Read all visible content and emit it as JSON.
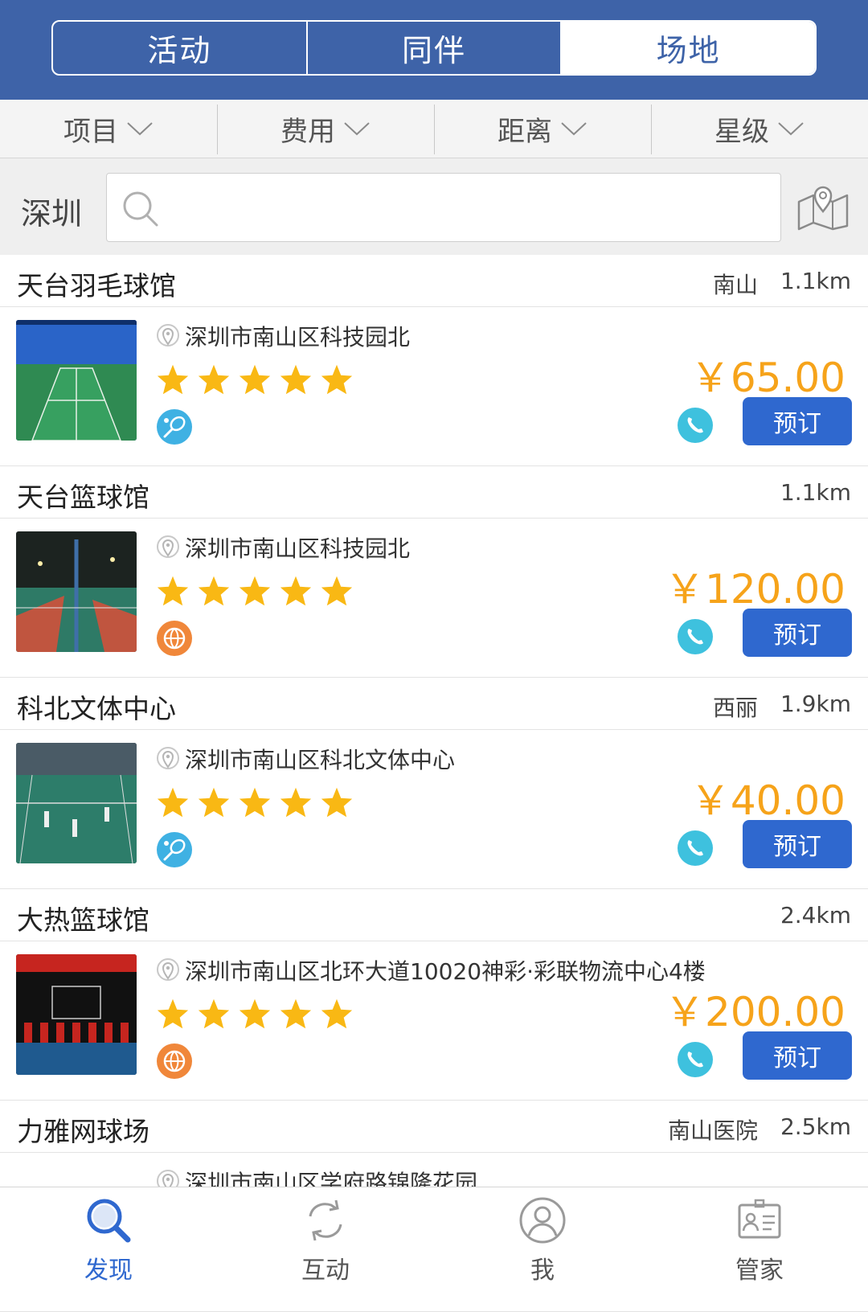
{
  "header": {
    "tabs": [
      {
        "label": "活动",
        "active": false
      },
      {
        "label": "同伴",
        "active": false
      },
      {
        "label": "场地",
        "active": true
      }
    ]
  },
  "filters": [
    "项目",
    "费用",
    "距离",
    "星级"
  ],
  "search": {
    "city": "深圳",
    "value": "",
    "placeholder": ""
  },
  "venues": [
    {
      "name": "天台羽毛球馆",
      "area": "南山",
      "distance": "1.1km",
      "address": "深圳市南山区科技园北",
      "rating": 5,
      "sport_icon": "badminton-icon",
      "price": "￥65.00",
      "book_label": "预订"
    },
    {
      "name": "天台篮球馆",
      "area": "",
      "distance": "1.1km",
      "address": "深圳市南山区科技园北",
      "rating": 5,
      "sport_icon": "basketball-icon",
      "price": "￥120.00",
      "book_label": "预订"
    },
    {
      "name": "科北文体中心",
      "area": "西丽",
      "distance": "1.9km",
      "address": "深圳市南山区科北文体中心",
      "rating": 5,
      "sport_icon": "badminton-icon",
      "price": "￥40.00",
      "book_label": "预订"
    },
    {
      "name": "大热篮球馆",
      "area": "",
      "distance": "2.4km",
      "address": "深圳市南山区北环大道10020神彩·彩联物流中心4楼",
      "rating": 5,
      "sport_icon": "basketball-icon",
      "price": "￥200.00",
      "book_label": "预订"
    },
    {
      "name": "力雅网球场",
      "area": "南山医院",
      "distance": "2.5km",
      "address": "深圳市南山区学府路锦隆花园"
    }
  ],
  "bottom_nav": [
    {
      "label": "发现",
      "icon": "search-icon",
      "active": true
    },
    {
      "label": "互动",
      "icon": "sync-icon",
      "active": false
    },
    {
      "label": "我",
      "icon": "user-icon",
      "active": false
    },
    {
      "label": "管家",
      "icon": "contact-card-icon",
      "active": false
    }
  ],
  "colors": {
    "header_bg": "#3E63A8",
    "accent": "#2F68CF",
    "price": "#F6A31A",
    "star": "#F9B814",
    "phone": "#3EC1DE",
    "badminton": "#3FB1E3",
    "basketball": "#F0873A"
  }
}
